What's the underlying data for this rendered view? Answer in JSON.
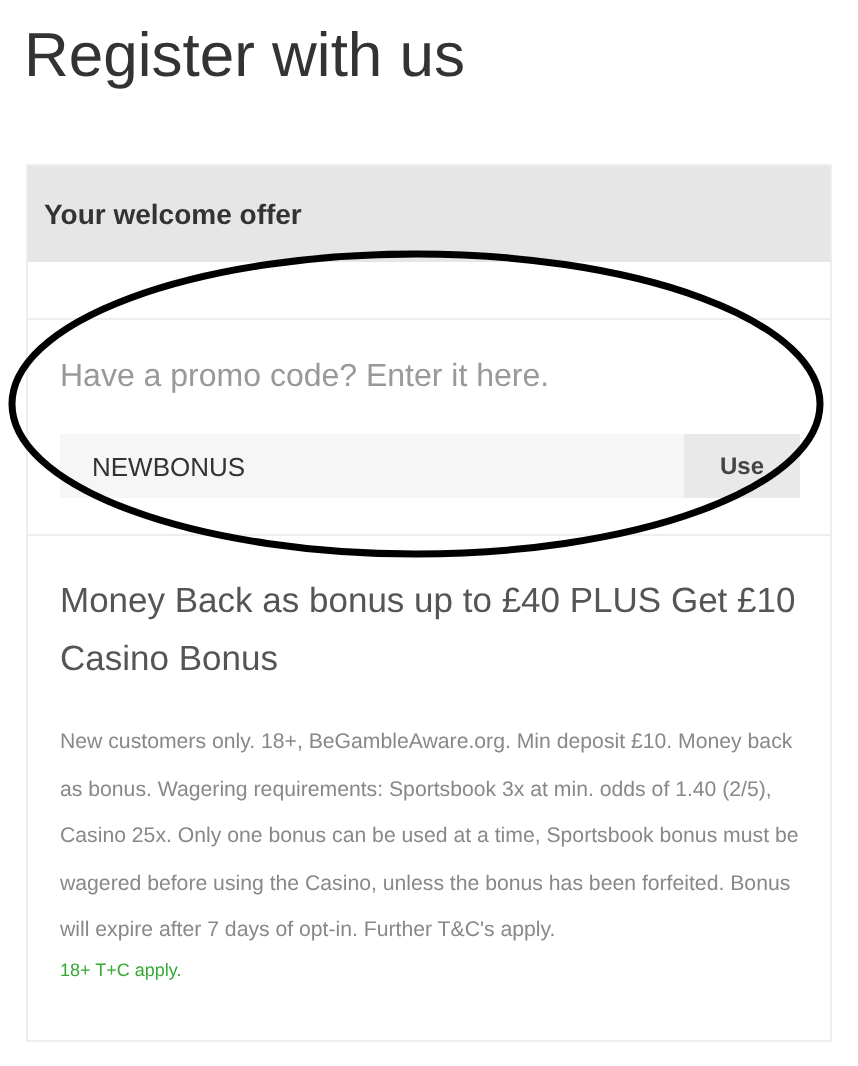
{
  "title": "Register with us",
  "panel": {
    "header": "Your welcome offer",
    "promo": {
      "label": "Have a promo code? Enter it here.",
      "value": "NEWBONUS",
      "button": "Use"
    },
    "offer": {
      "title": "Money Back as bonus up to £40 PLUS Get £10 Casino Bonus",
      "terms": "New customers only. 18+, BeGambleAware.org. Min deposit £10. Money back as bonus. Wagering requirements: Sportsbook 3x at min. odds of 1.40 (2/5), Casino 25x. Only one bonus can be used at a time, Sportsbook bonus must be wagered before using the Casino, unless the bonus has been forfeited. Bonus will expire after 7 days of opt-in. Further T&C's apply.",
      "note": "18+ T+C apply."
    }
  }
}
